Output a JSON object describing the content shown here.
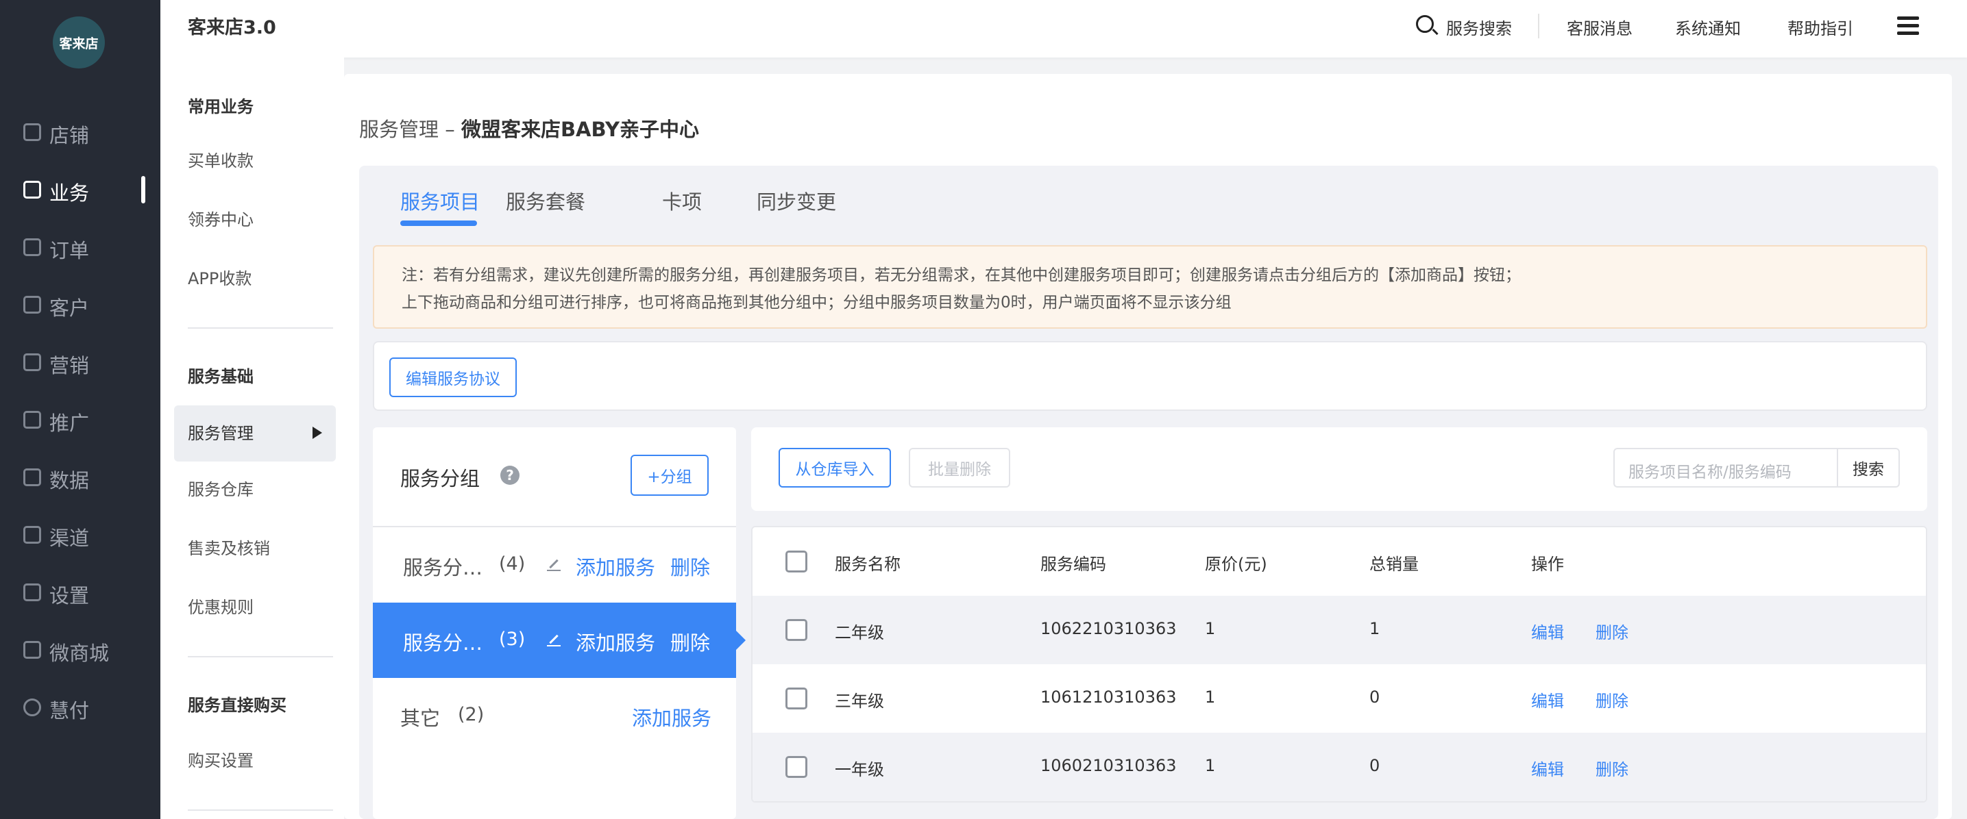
{
  "logo": {
    "text": "客来店"
  },
  "leftnav": [
    {
      "label": "店铺",
      "active": false
    },
    {
      "label": "业务",
      "active": true
    },
    {
      "label": "订单",
      "active": false
    },
    {
      "label": "客户",
      "active": false
    },
    {
      "label": "营销",
      "active": false
    },
    {
      "label": "推广",
      "active": false
    },
    {
      "label": "数据",
      "active": false
    },
    {
      "label": "渠道",
      "active": false
    },
    {
      "label": "设置",
      "active": false
    },
    {
      "label": "微商城",
      "active": false
    },
    {
      "label": "慧付",
      "active": false
    }
  ],
  "topbar": {
    "title": "客来店3.0",
    "search_label": "服务搜索",
    "links": [
      "客服消息",
      "系统通知",
      "帮助指引"
    ]
  },
  "subnav": {
    "sections": [
      {
        "heading": "常用业务",
        "items": [
          "买单收款",
          "领券中心",
          "APP收款"
        ]
      },
      {
        "heading": "服务基础",
        "items": [
          "服务管理",
          "服务仓库",
          "售卖及核销",
          "优惠规则"
        ]
      },
      {
        "heading": "服务直接购买",
        "items": [
          "购买设置"
        ]
      }
    ],
    "active_item": "服务管理"
  },
  "main": {
    "breadcrumb_prefix": "服务管理 – ",
    "breadcrumb_store": "微盟客来店BABY亲子中心",
    "tabs": [
      "服务项目",
      "服务套餐",
      "卡项",
      "同步变更"
    ],
    "active_tab": "服务项目",
    "notice_line1": "注：若有分组需求，建议先创建所需的服务分组，再创建服务项目，若无分组需求，在其他中创建服务项目即可；创建服务请点击分组后方的【添加商品】按钮；",
    "notice_line2": "上下拖动商品和分组可进行排序，也可将商品拖到其他分组中；分组中服务项目数量为0时，用户端页面将不显示该分组",
    "edit_agreement_button": "编辑服务协议"
  },
  "groups": {
    "title": "服务分组",
    "add_group_button": "+分组",
    "help_icon": "?",
    "rows": [
      {
        "name": "服务分…",
        "count": "(4)",
        "add": "添加服务",
        "del": "删除",
        "active": false
      },
      {
        "name": "服务分…",
        "count": "(3)",
        "add": "添加服务",
        "del": "删除",
        "active": true
      },
      {
        "name": "其它",
        "count": "(2)",
        "add": "添加服务",
        "active": false
      }
    ]
  },
  "list": {
    "import_button": "从仓库导入",
    "batch_delete_button": "批量删除",
    "search_placeholder": "服务项目名称/服务编码",
    "search_button": "搜索",
    "columns": [
      "服务名称",
      "服务编码",
      "原价(元)",
      "总销量",
      "操作"
    ],
    "rows": [
      {
        "name": "二年级",
        "code": "1062210310363",
        "price": "1",
        "sales": "1",
        "edit": "编辑",
        "delete": "删除"
      },
      {
        "name": "三年级",
        "code": "1061210310363",
        "price": "1",
        "sales": "0",
        "edit": "编辑",
        "delete": "删除"
      },
      {
        "name": "一年级",
        "code": "1060210310363",
        "price": "1",
        "sales": "0",
        "edit": "编辑",
        "delete": "删除"
      }
    ]
  },
  "colors": {
    "accent": "#3a86f5",
    "nav_bg": "#262b35",
    "notice_bg": "#fdf5ec"
  }
}
